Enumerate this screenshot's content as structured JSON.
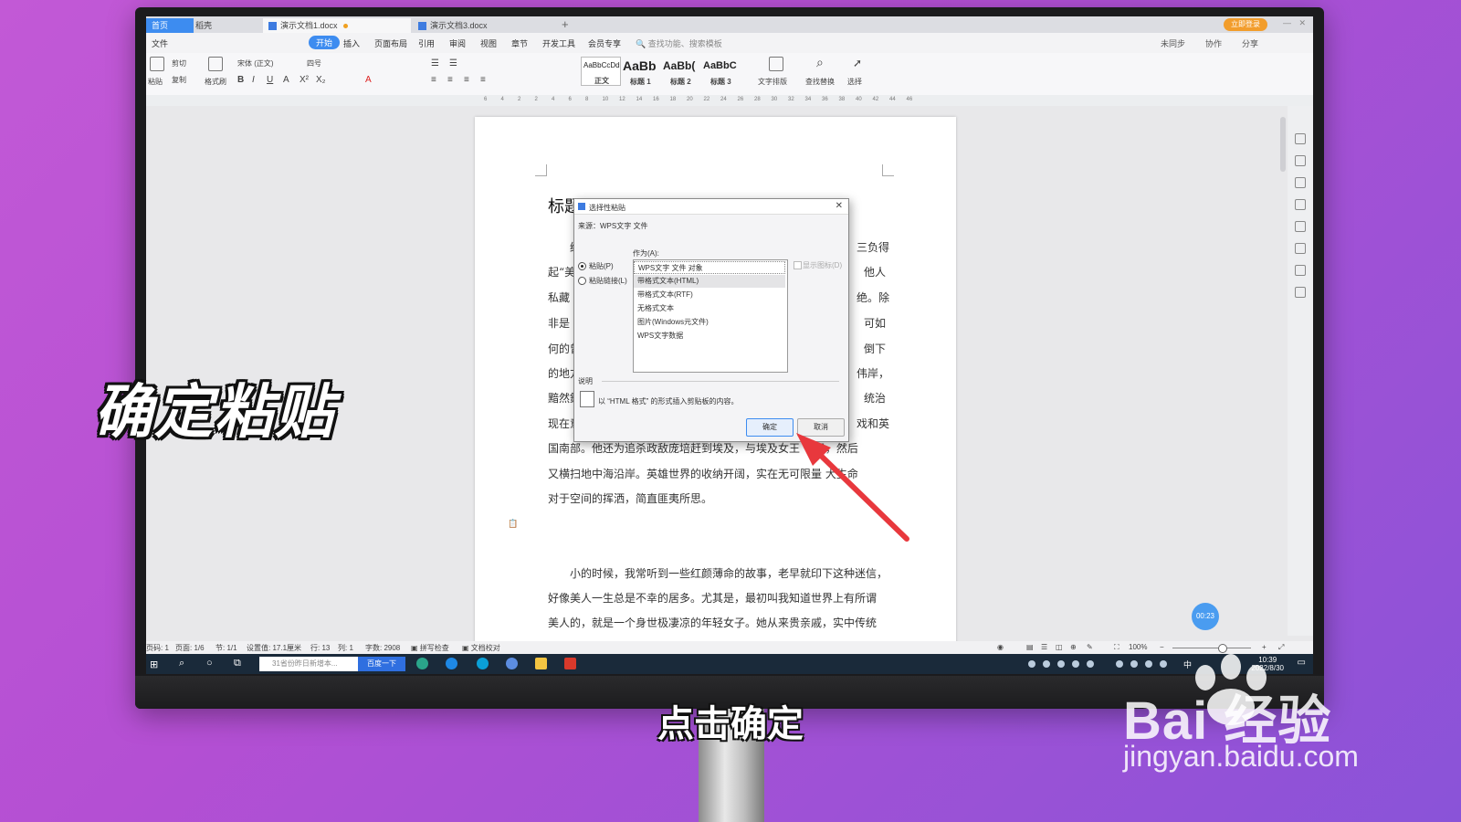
{
  "tabs": {
    "home": "首页",
    "t1": "稻壳",
    "t2": "演示文档1.docx",
    "t3": "演示文档3.docx",
    "login": "立即登录"
  },
  "menu": {
    "items": [
      "文件",
      "开始",
      "插入",
      "页面布局",
      "引用",
      "审阅",
      "视图",
      "章节",
      "开发工具",
      "会员专享"
    ],
    "search": "查找功能、搜索模板",
    "right": [
      "未同步",
      "协作",
      "分享"
    ]
  },
  "ribbon": {
    "paste": "粘贴",
    "cut": "剪切",
    "copy": "复制",
    "format_painter": "格式刷",
    "font": "宋体 (正文)",
    "size": "四号",
    "styles": [
      {
        "sample": "AaBbCcDd",
        "label": "正文"
      },
      {
        "sample": "AaBb",
        "label": "标题 1"
      },
      {
        "sample": "AaBb(",
        "label": "标题 2"
      },
      {
        "sample": "AaBbC",
        "label": "标题 3"
      }
    ],
    "text_layout": "文字排版",
    "find_replace": "查找替换",
    "select": "选择"
  },
  "ruler": [
    "6",
    "4",
    "2",
    "2",
    "4",
    "6",
    "8",
    "10",
    "12",
    "14",
    "16",
    "18",
    "20",
    "22",
    "24",
    "26",
    "28",
    "30",
    "32",
    "34",
    "36",
    "38",
    "40",
    "42",
    "44",
    "46"
  ],
  "document": {
    "title": "标题",
    "lines": [
      "绿",
      "起“美",
      "私藏",
      "非是",
      "何的曾",
      "的地方",
      "黯然鍾",
      "现在意",
      "国南部。他还为追杀政敌庞培赶到埃及，与埃及女王     一子，然后",
      "又横扫地中海沿岸。英雄世界的收纳开阔，实在无可限量     大生命",
      "对于空间的挥洒，简直匪夷所思。",
      "小的时候，我常听到一些红颜薄命的故事，老早就印下这种迷信，",
      "好像美人一生总是不幸的居多。尤其是，最初叫我知道世界上有所谓",
      "美人的，就是一个身世极凄凉的年轻女子。她从来贵亲戚，实中传统"
    ],
    "right_fragments": [
      "三负得",
      "他人",
      "绝。除",
      "可如",
      "倒下",
      "伟岸，",
      "统治",
      "戏和英"
    ]
  },
  "dialog": {
    "title": "选择性粘贴",
    "source": "来源：WPS文字 文件",
    "as_label": "作为(A):",
    "paste": "粘贴(P)",
    "paste_link": "粘贴链接(L)",
    "show_icon": "显示图标(D)",
    "options": [
      "WPS文字 文件 对象",
      "带格式文本(HTML)",
      "带格式文本(RTF)",
      "无格式文本",
      "图片(Windows元文件)",
      "WPS文字数据"
    ],
    "selected_index": 1,
    "desc_label": "说明",
    "desc": "以 “HTML 格式” 的形式插入剪贴板的内容。",
    "ok": "确定",
    "cancel": "取消"
  },
  "status": {
    "page": "页码: 1",
    "pages": "页面: 1/6",
    "section": "节: 1/1",
    "setting": "设置值: 17.1厘米",
    "row": "行: 13",
    "col": "列: 1",
    "words": "字数: 2908",
    "spell": "拼写检查",
    "proof": "文档校对",
    "zoom": "100%"
  },
  "taskbar": {
    "search": "31省份昨日新增本...",
    "baidu": "百度一下",
    "time": "10:39",
    "date": "2022/8/30",
    "ime": "中"
  },
  "timer": "00:23",
  "overlay_caption": "确定粘贴",
  "subtitle": "点击确定",
  "watermark": {
    "brand": "Bai 经验",
    "url": "jingyan.baidu.com"
  },
  "colors": {
    "accent": "#3d8cf0",
    "arrow": "#e8383d",
    "background": "#b44fd3"
  }
}
